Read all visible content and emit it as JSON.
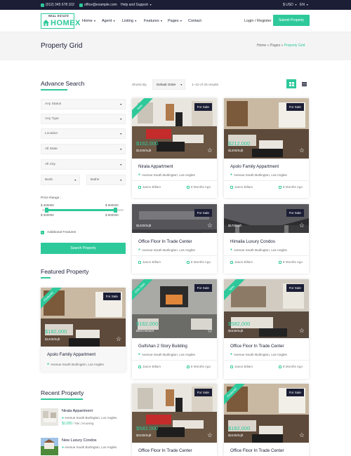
{
  "topbar": {
    "phone": "(012) 345 678 102",
    "email": "office@example.com",
    "help": "Help and Support",
    "currency": "$ USD",
    "language": "EN"
  },
  "header": {
    "logo_top": "REAL ESTATE",
    "logo_main": "HOMEX",
    "nav": [
      "Home",
      "Agent",
      "Listing",
      "Features",
      "Pages",
      "Contact"
    ],
    "login": "Login / Register",
    "submit": "Submit Property"
  },
  "page": {
    "title": "Property Grid",
    "breadcrumb": [
      "Home",
      "Pages",
      "Property Grid"
    ]
  },
  "search": {
    "title": "Advance Search",
    "status": "Any Status",
    "type": "Any Type",
    "location": "Location",
    "state": "All State",
    "city": "All City",
    "beds": "Beds",
    "baths": "Baths",
    "price_label": "Price Range :",
    "price_min": "$ 300000",
    "price_max": "$ 900000",
    "range_low": "$ 300000",
    "range_high": "$ 900000",
    "range_fill_start": 0.05,
    "range_fill_end": 0.9,
    "additional": "Additional Features",
    "button": "Search Property"
  },
  "featured": {
    "title": "Featured Property",
    "ribbon": "Featured",
    "status": "For Sale",
    "price": "$182,000",
    "sqft": "$1200/Sqft",
    "name": "Apolo Family Appartment",
    "address": "Avenue South Burlington, Los Angles"
  },
  "recent": {
    "title": "Recent Property",
    "items": [
      {
        "name": "Nirala Appartment",
        "address": "Avenue South Burlington, Los Angles",
        "price": "$1280",
        "unit": "/ Mo",
        "type": "Housing"
      },
      {
        "name": "New Luxury Condos",
        "address": "Avenue South Burlington, Los Angles"
      }
    ]
  },
  "toolbar": {
    "sort_label": "Shorts By",
    "sort_value": "Default Order",
    "results": "1–10 of 25 results"
  },
  "listings": [
    {
      "title": "Nirala Appartment",
      "address": "Avenue South Burlington, Los Angles",
      "agent": "Jason Billam",
      "date": "8 Months Ago",
      "status": "For Sale",
      "ribbon": "New",
      "price": "$162,000",
      "sqft": "$1200/Sqft"
    },
    {
      "title": "Apolo Family Appartment",
      "address": "Avenue South Burlington, Los Angles",
      "agent": "Jason Billam",
      "date": "8 Months Ago",
      "status": "For Sale",
      "ribbon": "",
      "price": "$212,000",
      "sqft": "$1200/Sqft"
    },
    {
      "title": "Office Floor In Trade Center",
      "address": "Avenue South Burlington, Los Angles",
      "agent": "Jason Billam",
      "date": "8 Months Ago",
      "status": "For Sale",
      "ribbon": "",
      "price": "",
      "sqft": "$1200/Sqft"
    },
    {
      "title": "Himalia Luxury Condos",
      "address": "Avenue South Burlington, Los Angles",
      "agent": "Jason Billam",
      "date": "8 Months Ago",
      "status": "For Sale",
      "ribbon": "",
      "price": "",
      "sqft": "$170/Sqft"
    },
    {
      "title": "Gulfshan 2 Story Building",
      "address": "Avenue South Burlington, Los Angles",
      "agent": "Jason Billam",
      "date": "8 Months Ago",
      "status": "For Sale",
      "ribbon": "10% Sale",
      "price": "$162,000",
      "sqft": "Best Amount"
    },
    {
      "title": "Office Floor In Trade Center",
      "address": "Avenue South Burlington, Los Angles",
      "agent": "Jason Billam",
      "date": "8 Months Ago",
      "status": "For Sale",
      "ribbon": "New",
      "price": "$582,000",
      "sqft": "$2430/Sqft"
    },
    {
      "title": "Office Floor In Trade Center",
      "address": "",
      "agent": "",
      "date": "",
      "status": "For Sale",
      "ribbon": "",
      "price": "$582,000",
      "sqft": "$2430/Sqft"
    },
    {
      "title": "Office Floor In Trade Center",
      "address": "",
      "agent": "",
      "date": "",
      "status": "For Sale",
      "ribbon": "Featured",
      "price": "$182,000",
      "sqft": "$2430/Sqft"
    }
  ]
}
